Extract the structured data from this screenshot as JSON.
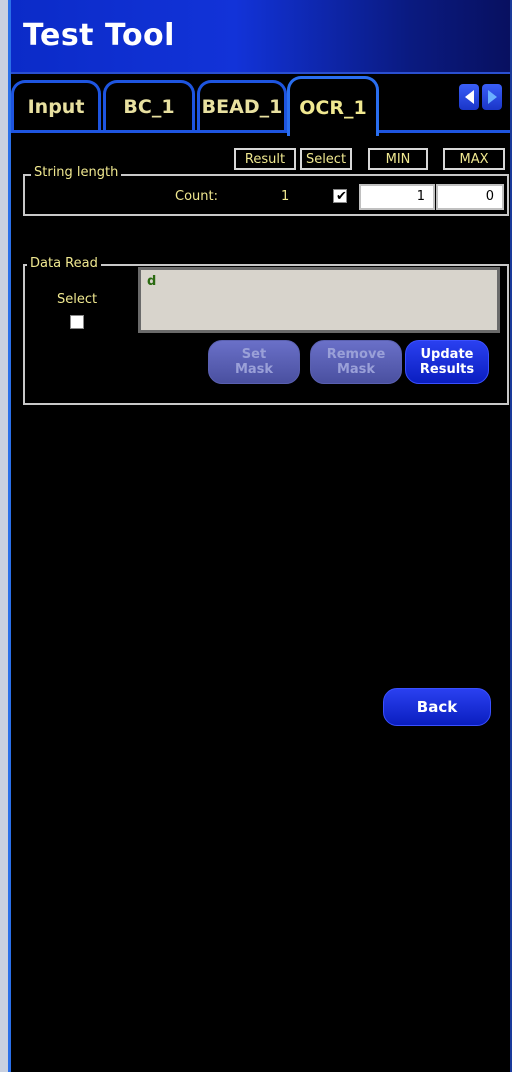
{
  "app": {
    "title": "Test Tool"
  },
  "tabs": [
    {
      "label": "Input",
      "active": false
    },
    {
      "label": "BC_1",
      "active": false
    },
    {
      "label": "BEAD_1",
      "active": false
    },
    {
      "label": "OCR_1",
      "active": true
    }
  ],
  "tab_nav": {
    "left_icon": "triangle-left-icon",
    "right_icon": "triangle-right-icon"
  },
  "string_length": {
    "group_label": "String length",
    "headers": {
      "result": "Result",
      "select": "Select",
      "min": "MIN",
      "max": "MAX"
    },
    "row_label": "Count:",
    "result_value": "1",
    "select_checked": true,
    "min_value": "1",
    "max_value": "0"
  },
  "data_read": {
    "group_label": "Data Read",
    "select_label": "Select",
    "select_checked": false,
    "field_value": "d",
    "buttons": {
      "set_mask_line1": "Set",
      "set_mask_line2": "Mask",
      "remove_mask_line1": "Remove",
      "remove_mask_line2": "Mask",
      "update_line1": "Update",
      "update_line2": "Results"
    }
  },
  "footer": {
    "back_label": "Back"
  },
  "colors": {
    "title_bar": "#1233d8",
    "background": "#000000",
    "label_text": "#f0e890",
    "tab_border": "#1e55e0",
    "button_enabled": "#1a30e0",
    "button_disabled": "#5a60b0"
  }
}
